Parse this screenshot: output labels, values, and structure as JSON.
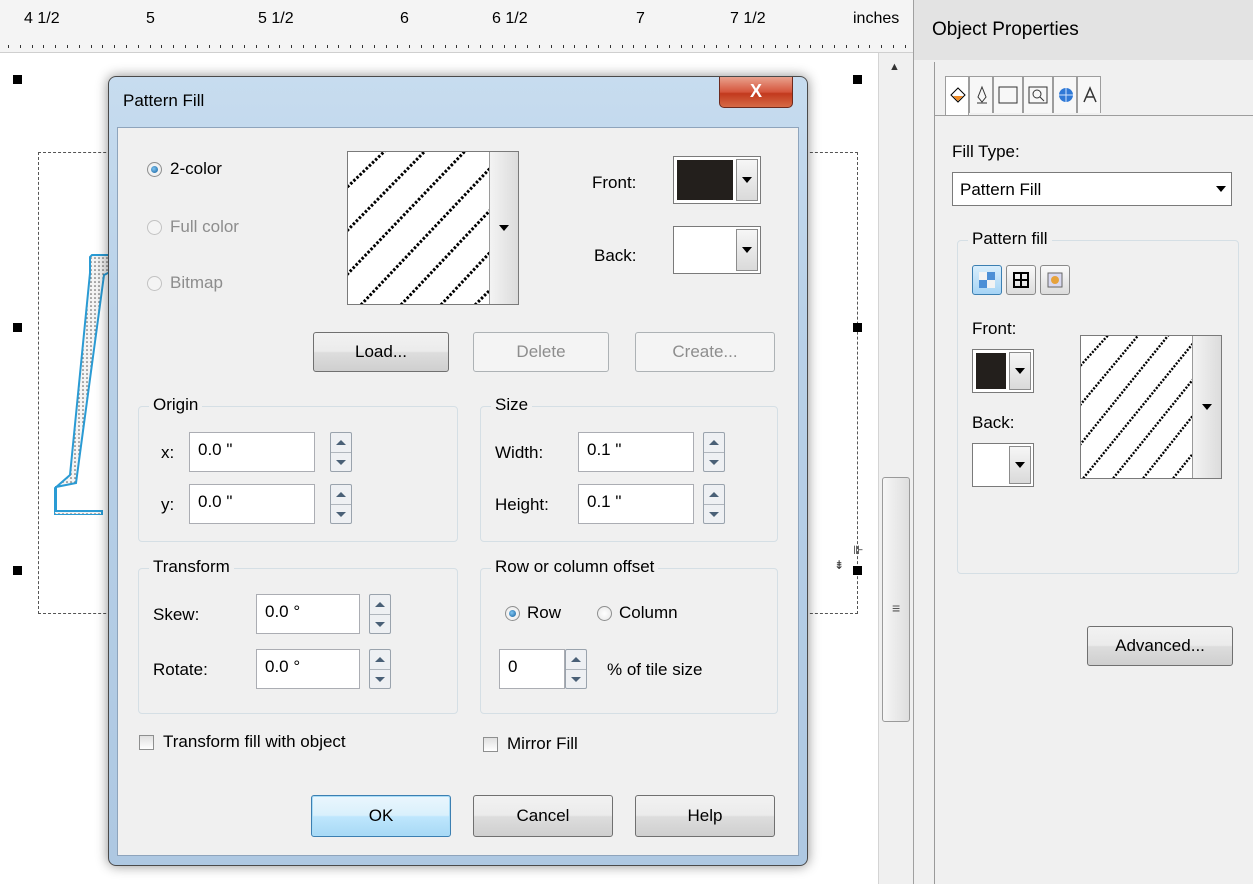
{
  "ruler": {
    "labels": [
      "4 1/2",
      "5",
      "5 1/2",
      "6",
      "6 1/2",
      "7",
      "7 1/2",
      "inches"
    ]
  },
  "panel": {
    "title": "Object Properties",
    "fill_type_label": "Fill Type:",
    "fill_type_value": "Pattern Fill",
    "group_title": "Pattern fill",
    "front_label": "Front:",
    "back_label": "Back:",
    "advanced_label": "Advanced...",
    "front_color": "#231f1c",
    "back_color": "#ffffff",
    "tabs": [
      "fill-icon",
      "outline-pen-icon",
      "frame-icon",
      "summary-icon",
      "internet-icon",
      "text-icon"
    ]
  },
  "dialog": {
    "title": "Pattern Fill",
    "close_label": "X",
    "type_options": {
      "two_color": "2-color",
      "full_color": "Full color",
      "bitmap": "Bitmap"
    },
    "front_label": "Front:",
    "back_label": "Back:",
    "front_color": "#231f1c",
    "back_color": "#ffffff",
    "buttons": {
      "load": "Load...",
      "delete": "Delete",
      "create": "Create...",
      "ok": "OK",
      "cancel": "Cancel",
      "help": "Help"
    },
    "origin": {
      "title": "Origin",
      "x_label": "x:",
      "x_value": "0.0 \"",
      "y_label": "y:",
      "y_value": "0.0 \""
    },
    "size": {
      "title": "Size",
      "width_label": "Width:",
      "width_value": "0.1 \"",
      "height_label": "Height:",
      "height_value": "0.1 \""
    },
    "transform": {
      "title": "Transform",
      "skew_label": "Skew:",
      "skew_value": "0.0 °",
      "rotate_label": "Rotate:",
      "rotate_value": "0.0 °"
    },
    "offset": {
      "title": "Row or column offset",
      "row_label": "Row",
      "column_label": "Column",
      "value": "0",
      "unit_label": "% of tile size"
    },
    "transform_fill_label": "Transform fill with object",
    "mirror_fill_label": "Mirror Fill"
  }
}
